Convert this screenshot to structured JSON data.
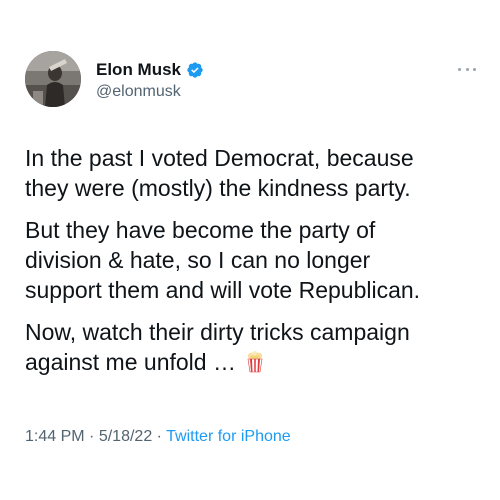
{
  "author": {
    "display_name": "Elon Musk",
    "handle": "@elonmusk",
    "verified_icon": "verified-badge-icon",
    "accent_color": "#1d9bf0"
  },
  "more_icon": "more-dots-icon",
  "tweet": {
    "paragraphs": [
      {
        "lines": [
          "In the past I voted Democrat, because",
          "they were (mostly) the kindness party."
        ]
      },
      {
        "lines": [
          "But they have become the party of",
          "division & hate, so I can no longer",
          "support them and will vote Republican."
        ]
      },
      {
        "lines": [
          "Now, watch their dirty tricks campaign",
          "against me unfold …"
        ],
        "trailing_emoji": "popcorn-icon"
      }
    ]
  },
  "meta": {
    "time": "1:44 PM",
    "separator": "·",
    "date": "5/18/22",
    "source": "Twitter for iPhone"
  }
}
